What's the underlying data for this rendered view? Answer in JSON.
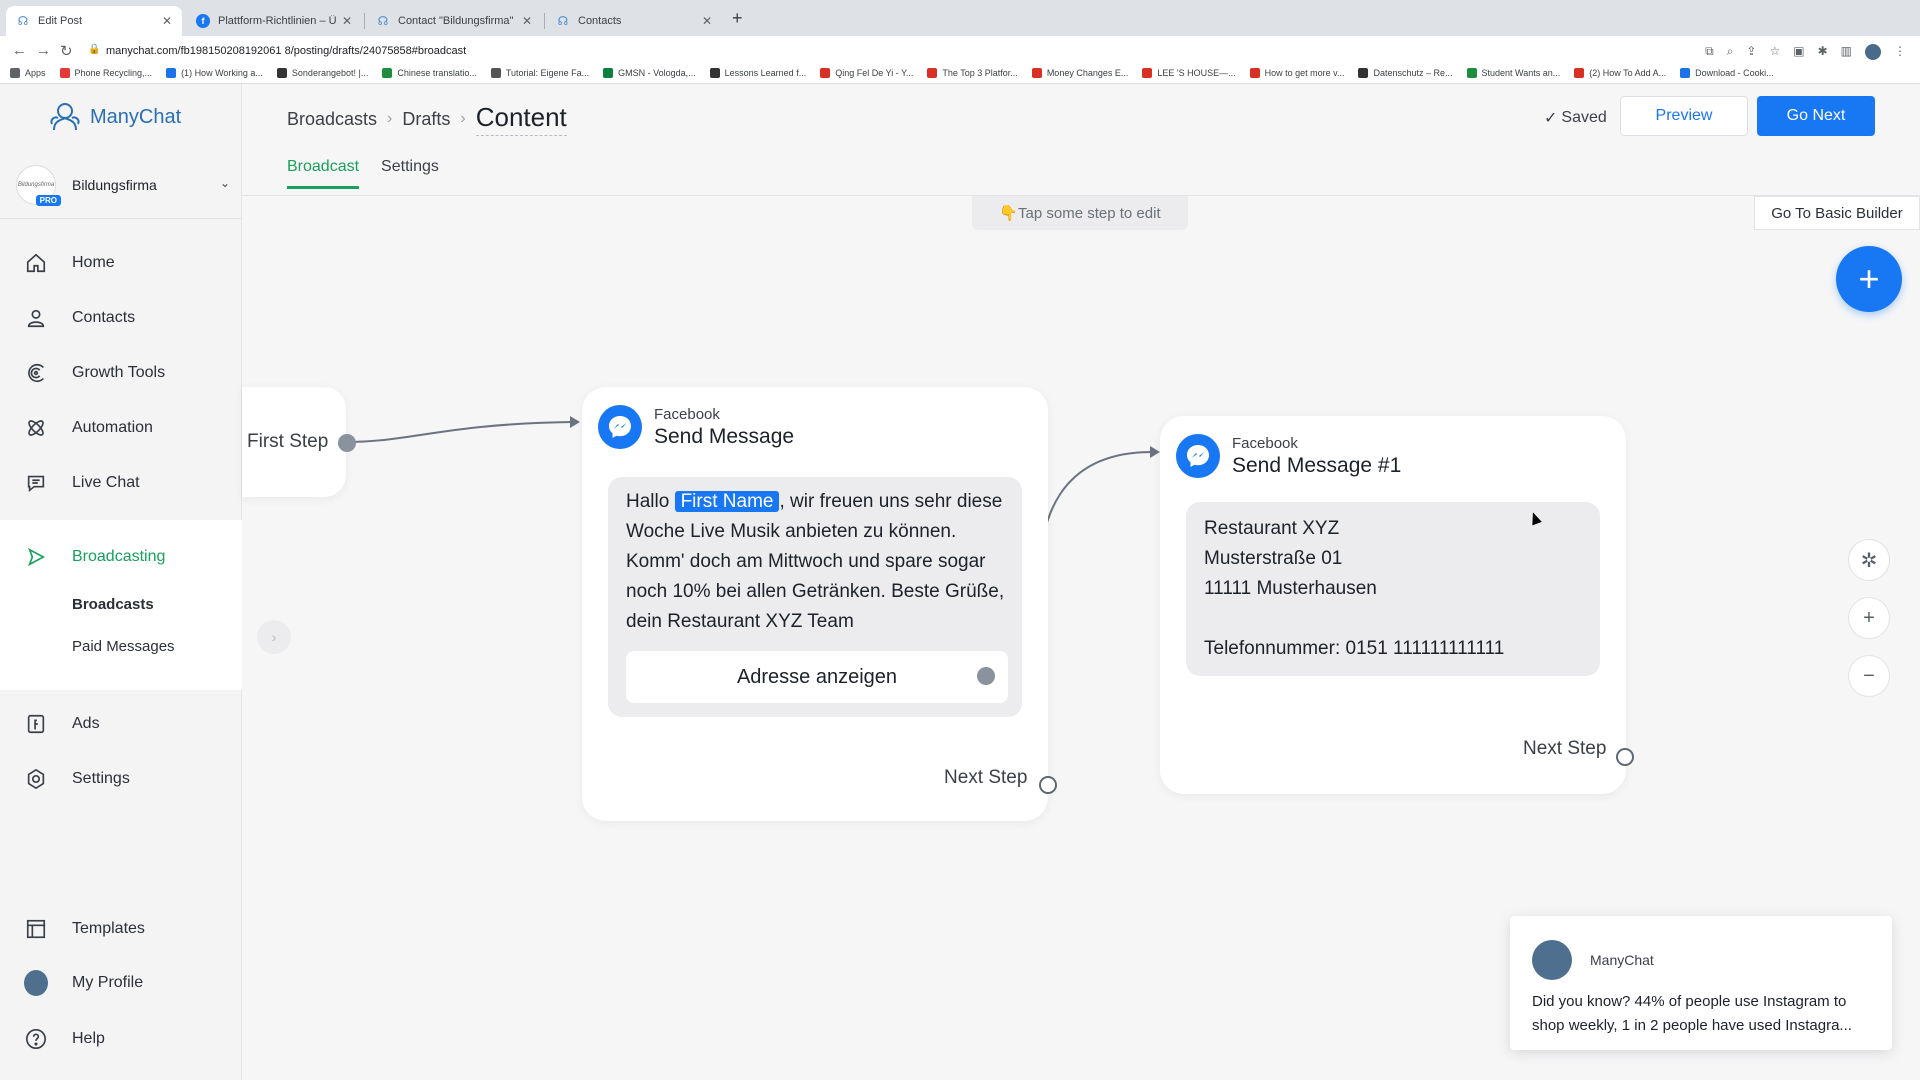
{
  "browser": {
    "tabs": [
      {
        "title": "Edit Post",
        "active": true
      },
      {
        "title": "Plattform-Richtlinien – Übersicht"
      },
      {
        "title": "Contact \"Bildungsfirma\" through"
      },
      {
        "title": "Contacts"
      }
    ],
    "url": "manychat.com/fb198150208192061 8/posting/drafts/24075858#broadcast",
    "bookmarks": [
      "Apps",
      "Phone Recycling,...",
      "(1) How Working a...",
      "Sonderangebot! |...",
      "Chinese translatio...",
      "Tutorial: Eigene Fa...",
      "GMSN - Vologda,...",
      "Lessons Learned f...",
      "Qing Fel De Yi - Y...",
      "The Top 3 Platfor...",
      "Money Changes E...",
      "LEE 'S HOUSE—...",
      "How to get more v...",
      "Datenschutz – Re...",
      "Student Wants an...",
      "(2) How To Add A...",
      "Download - Cooki..."
    ]
  },
  "sidebar": {
    "logo": "ManyChat",
    "account": {
      "name": "Bildungsfirma",
      "badge": "PRO"
    },
    "items": [
      {
        "label": "Home",
        "icon": "home-icon"
      },
      {
        "label": "Contacts",
        "icon": "user-icon"
      },
      {
        "label": "Growth Tools",
        "icon": "growth-tools-icon"
      },
      {
        "label": "Automation",
        "icon": "automation-icon"
      },
      {
        "label": "Live Chat",
        "icon": "chat-icon"
      },
      {
        "label": "Broadcasting",
        "icon": "send-icon",
        "active": true
      },
      {
        "label": "Ads",
        "icon": "ads-icon"
      },
      {
        "label": "Settings",
        "icon": "gear-icon"
      },
      {
        "label": "Templates",
        "icon": "templates-icon"
      },
      {
        "label": "My Profile",
        "icon": "avatar-icon"
      },
      {
        "label": "Help",
        "icon": "help-icon"
      }
    ],
    "sub_items": [
      {
        "label": "Broadcasts",
        "bold": true
      },
      {
        "label": "Paid Messages"
      }
    ]
  },
  "header": {
    "breadcrumbs": [
      "Broadcasts",
      "Drafts",
      "Content"
    ],
    "tabs": [
      {
        "label": "Broadcast",
        "active": true
      },
      {
        "label": "Settings"
      }
    ],
    "saved": "Saved",
    "preview": "Preview",
    "next": "Go Next"
  },
  "canvas": {
    "hint": "👇Tap some step to edit",
    "basic_builder": "Go To Basic Builder",
    "first_step": "First Step",
    "node1": {
      "platform": "Facebook",
      "title": "Send Message",
      "text_before": "Hallo ",
      "chip": "First Name",
      "text_after": ", wir freuen uns sehr diese Woche Live Musik anbieten zu können. Komm' doch am Mittwoch und spare sogar noch 10% bei allen Getränken. Beste Grüße, dein Restaurant XYZ Team",
      "button": "Adresse anzeigen",
      "next_step": "Next Step"
    },
    "node2": {
      "platform": "Facebook",
      "title": "Send Message #1",
      "lines": [
        "Restaurant XYZ",
        "Musterstraße 01",
        "11111 Musterhausen",
        "",
        "Telefonnummer: 0151 111111111111"
      ],
      "next_step": "Next Step"
    }
  },
  "toast": {
    "sender": "ManyChat",
    "message": "Did you know? 44% of people use Instagram to shop weekly, 1 in 2 people have used Instagra..."
  },
  "colors": {
    "brand_blue": "#1877f2",
    "active_green": "#18a05c"
  }
}
